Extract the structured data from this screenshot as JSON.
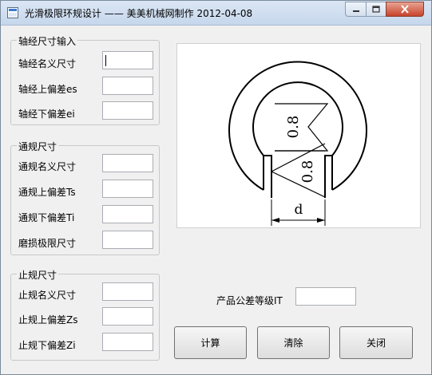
{
  "window": {
    "title": "光滑极限环规设计 —— 美美机械网制作  2012-04-08"
  },
  "shaft_group": {
    "legend": "轴经尺寸输入",
    "fields": [
      {
        "label": "轴经名义尺寸",
        "value": ""
      },
      {
        "label": "轴经上偏差es",
        "value": ""
      },
      {
        "label": "轴经下偏差ei",
        "value": ""
      }
    ]
  },
  "go_group": {
    "legend": "通规尺寸",
    "fields": [
      {
        "label": "通规名义尺寸",
        "value": ""
      },
      {
        "label": "通规上偏差Ts",
        "value": ""
      },
      {
        "label": "通规下偏差Ti",
        "value": ""
      },
      {
        "label": "磨损极限尺寸",
        "value": ""
      }
    ]
  },
  "nogo_group": {
    "legend": "止规尺寸",
    "fields": [
      {
        "label": "止规名义尺寸",
        "value": ""
      },
      {
        "label": "止规上偏差Zs",
        "value": ""
      },
      {
        "label": "止规下偏差Zi",
        "value": ""
      }
    ]
  },
  "grade": {
    "label": "产品公差等级IT",
    "value": ""
  },
  "buttons": {
    "calculate": "计算",
    "clear": "清除",
    "close": "关闭"
  },
  "diagram": {
    "roughness_top": "0.8",
    "roughness_bottom": "0.8",
    "dimension": "d"
  }
}
